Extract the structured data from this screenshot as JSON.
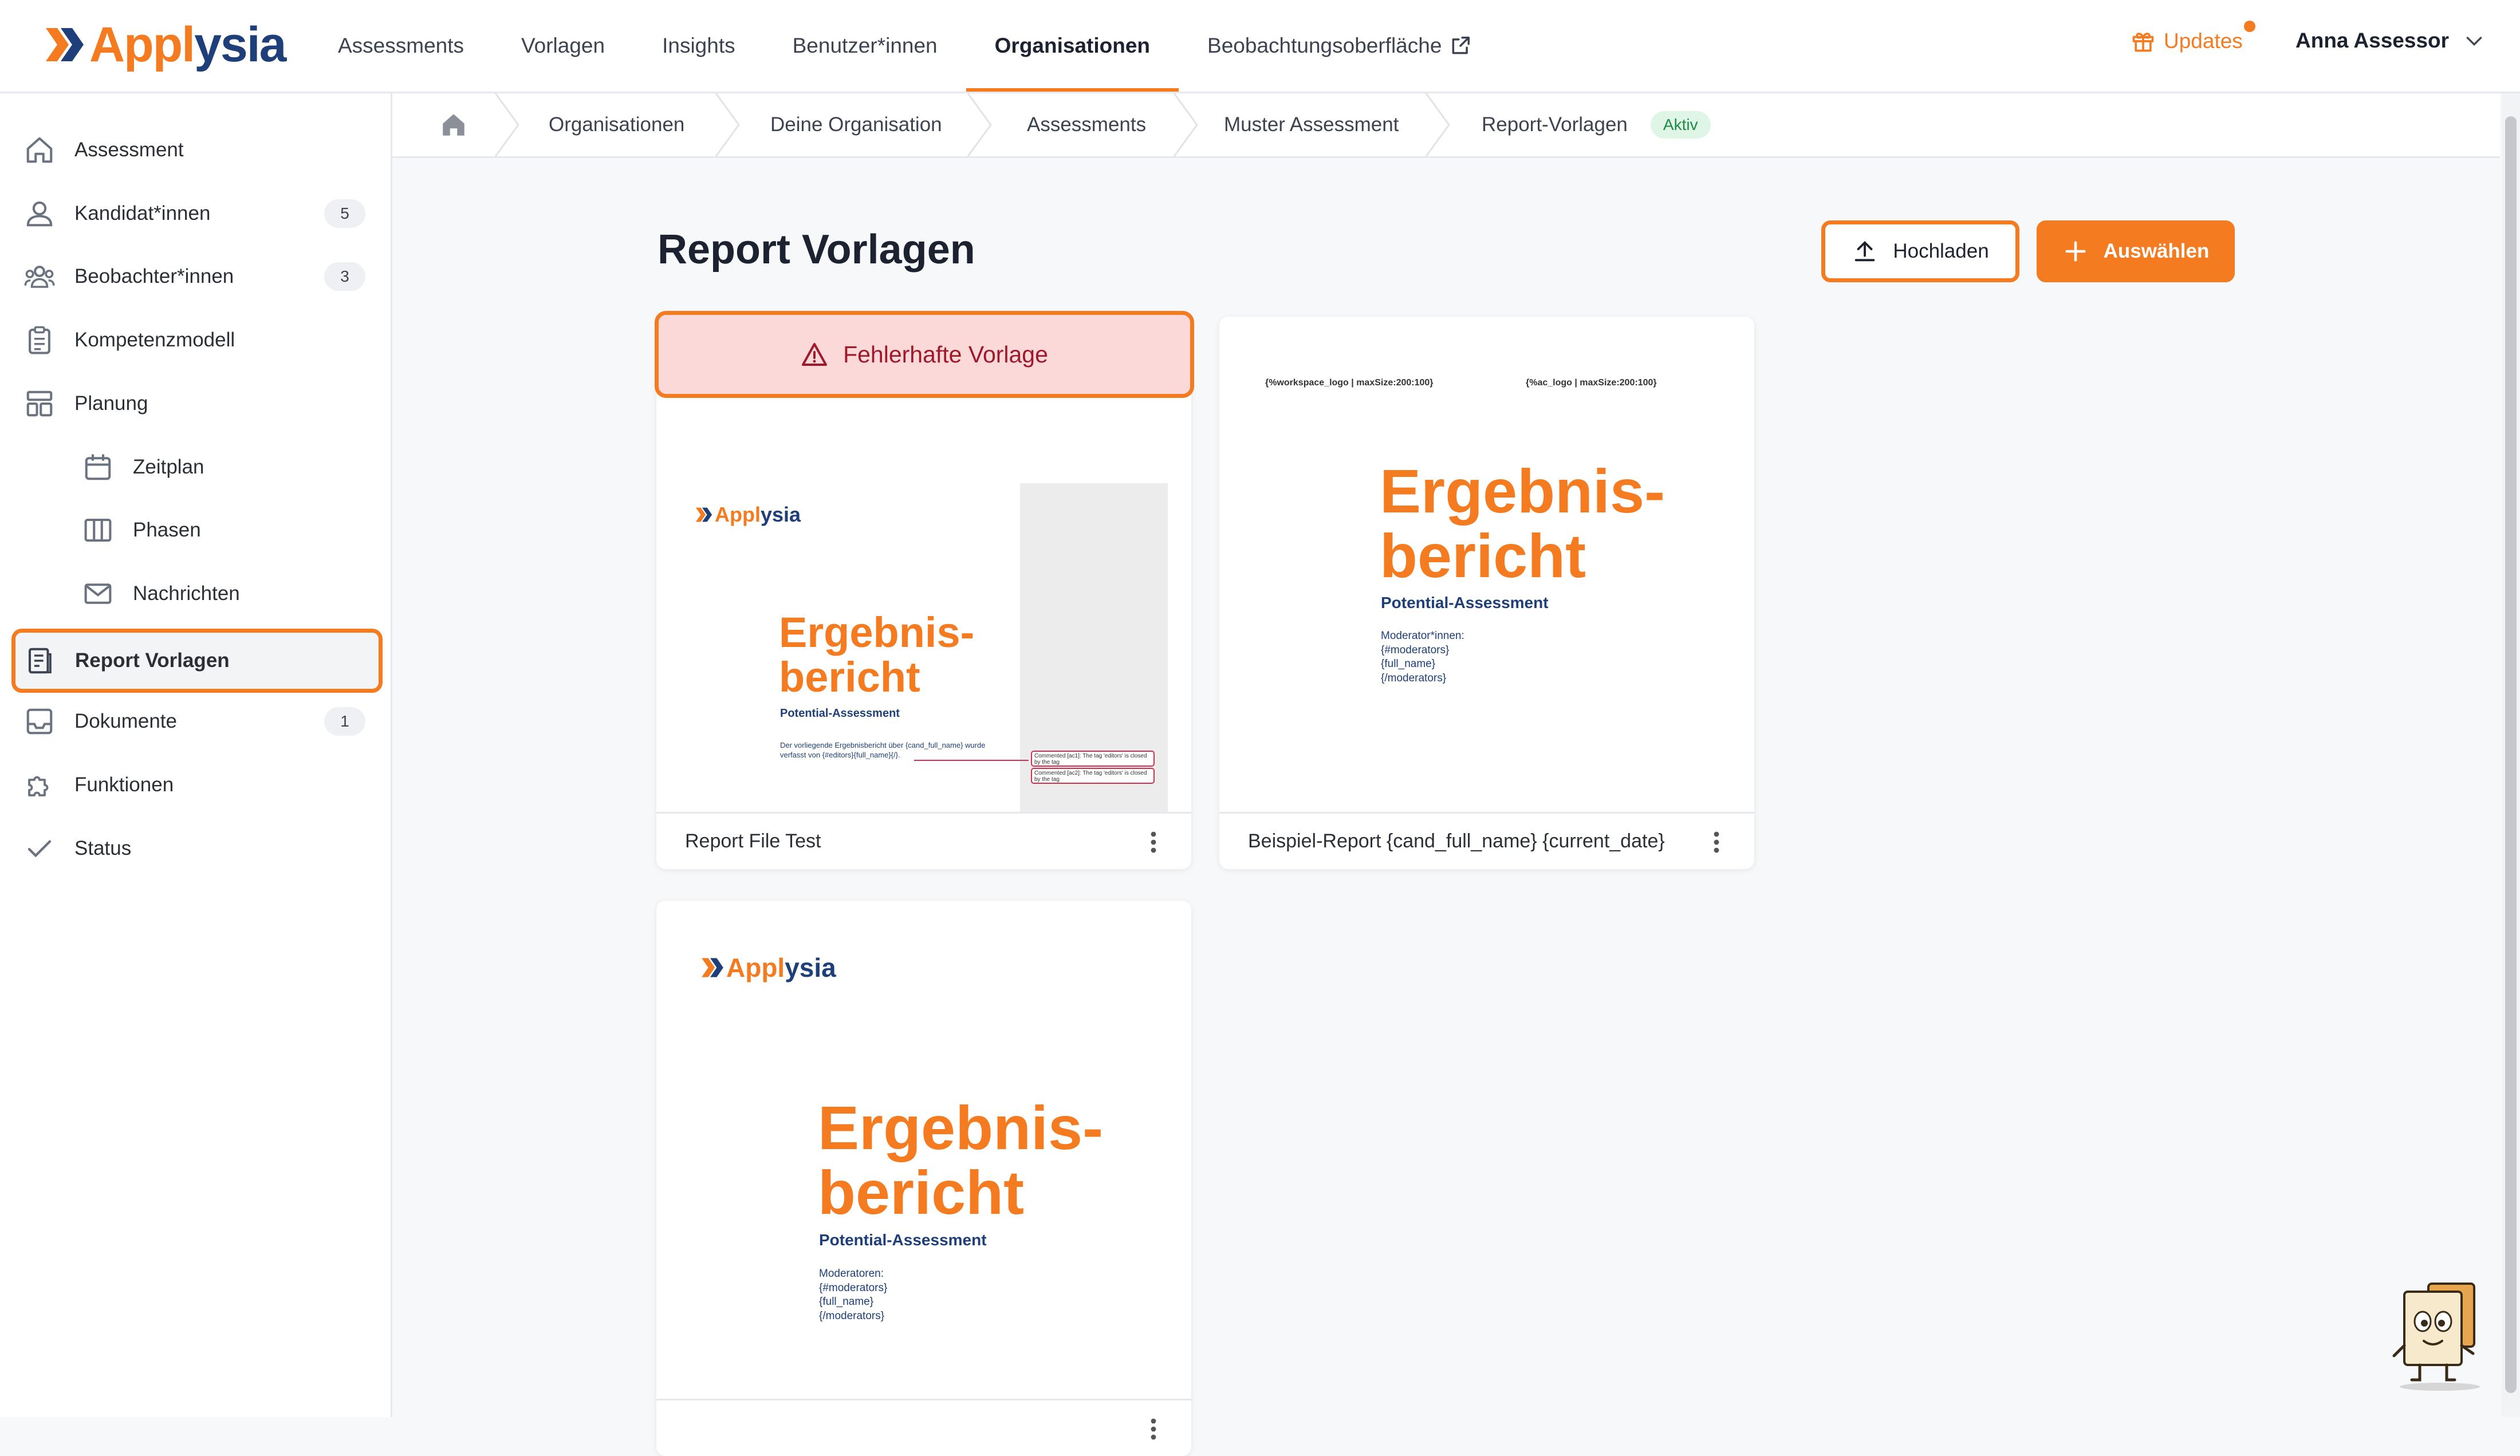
{
  "brand": {
    "logo_part1": "Appl",
    "logo_part2": "ysia"
  },
  "topnav": {
    "items": [
      "Assessments",
      "Vorlagen",
      "Insights",
      "Benutzer*innen",
      "Organisationen",
      "Beobachtungsoberfläche"
    ],
    "active": "Organisationen"
  },
  "header": {
    "updates_label": "Updates",
    "user_name": "Anna Assessor"
  },
  "sidebar": {
    "items": [
      {
        "label": "Assessment",
        "icon": "home-icon"
      },
      {
        "label": "Kandidat*innen",
        "badge": "5",
        "icon": "user-icon"
      },
      {
        "label": "Beobachter*innen",
        "badge": "3",
        "icon": "users-icon"
      },
      {
        "label": "Kompetenzmodell",
        "icon": "clipboard-icon"
      },
      {
        "label": "Planung",
        "icon": "layout-icon"
      },
      {
        "label": "Zeitplan",
        "icon": "calendar-icon"
      },
      {
        "label": "Phasen",
        "icon": "columns-icon"
      },
      {
        "label": "Nachrichten",
        "icon": "mail-icon"
      },
      {
        "label": "Report Vorlagen",
        "icon": "report-icon"
      },
      {
        "label": "Dokumente",
        "badge": "1",
        "icon": "inbox-icon"
      },
      {
        "label": "Funktionen",
        "icon": "puzzle-icon"
      },
      {
        "label": "Status",
        "icon": "check-icon"
      }
    ],
    "active": "Report Vorlagen"
  },
  "breadcrumb": {
    "items": [
      "Organisationen",
      "Deine Organisation",
      "Assessments",
      "Muster Assessment",
      "Report-Vorlagen"
    ],
    "status_badge": "Aktiv"
  },
  "main": {
    "title": "Report Vorlagen",
    "upload_button": "Hochladen",
    "select_button": "Auswählen",
    "error_banner": "Fehlerhafte Vorlage"
  },
  "cards": [
    {
      "name": "Report File Test",
      "preview": {
        "logo_part1": "Appl",
        "logo_part2": "ysia",
        "heading_line1": "Ergebnis-",
        "heading_line2": "bericht",
        "subheading": "Potential-Assessment",
        "body_line1": "Der vorliegende Ergebnisbericht über {cand_full_name} wurde",
        "body_line2": "verfasst von {#editors}{full_name}{/}.",
        "comment1": "Commented [ac1]: The tag 'editors' is closed by the tag",
        "comment2": "Commented [ac2]: The tag 'editors' is closed by the tag"
      }
    },
    {
      "name": "Beispiel-Report {cand_full_name} {current_date}",
      "preview": {
        "tag_left": "{%workspace_logo | maxSize:200:100}",
        "tag_right": "{%ac_logo | maxSize:200:100}",
        "heading_line1": "Ergebnis-",
        "heading_line2": "bericht",
        "subheading": "Potential-Assessment",
        "list": [
          "Moderator*innen:",
          "{#moderators}",
          "{full_name}",
          "{/moderators}"
        ]
      }
    },
    {
      "name": "",
      "preview": {
        "logo_part1": "Appl",
        "logo_part2": "ysia",
        "heading_line1": "Ergebnis-",
        "heading_line2": "bericht",
        "subheading": "Potential-Assessment",
        "list": [
          "Moderatoren:",
          "{#moderators}",
          "{full_name}",
          "{/moderators}"
        ]
      }
    }
  ],
  "colors": {
    "accent": "#f47b20",
    "brand_blue": "#1f3f7a",
    "error_bg": "#fbd9d9",
    "error_text": "#a0182a",
    "active_badge_bg": "#dff5e6"
  }
}
